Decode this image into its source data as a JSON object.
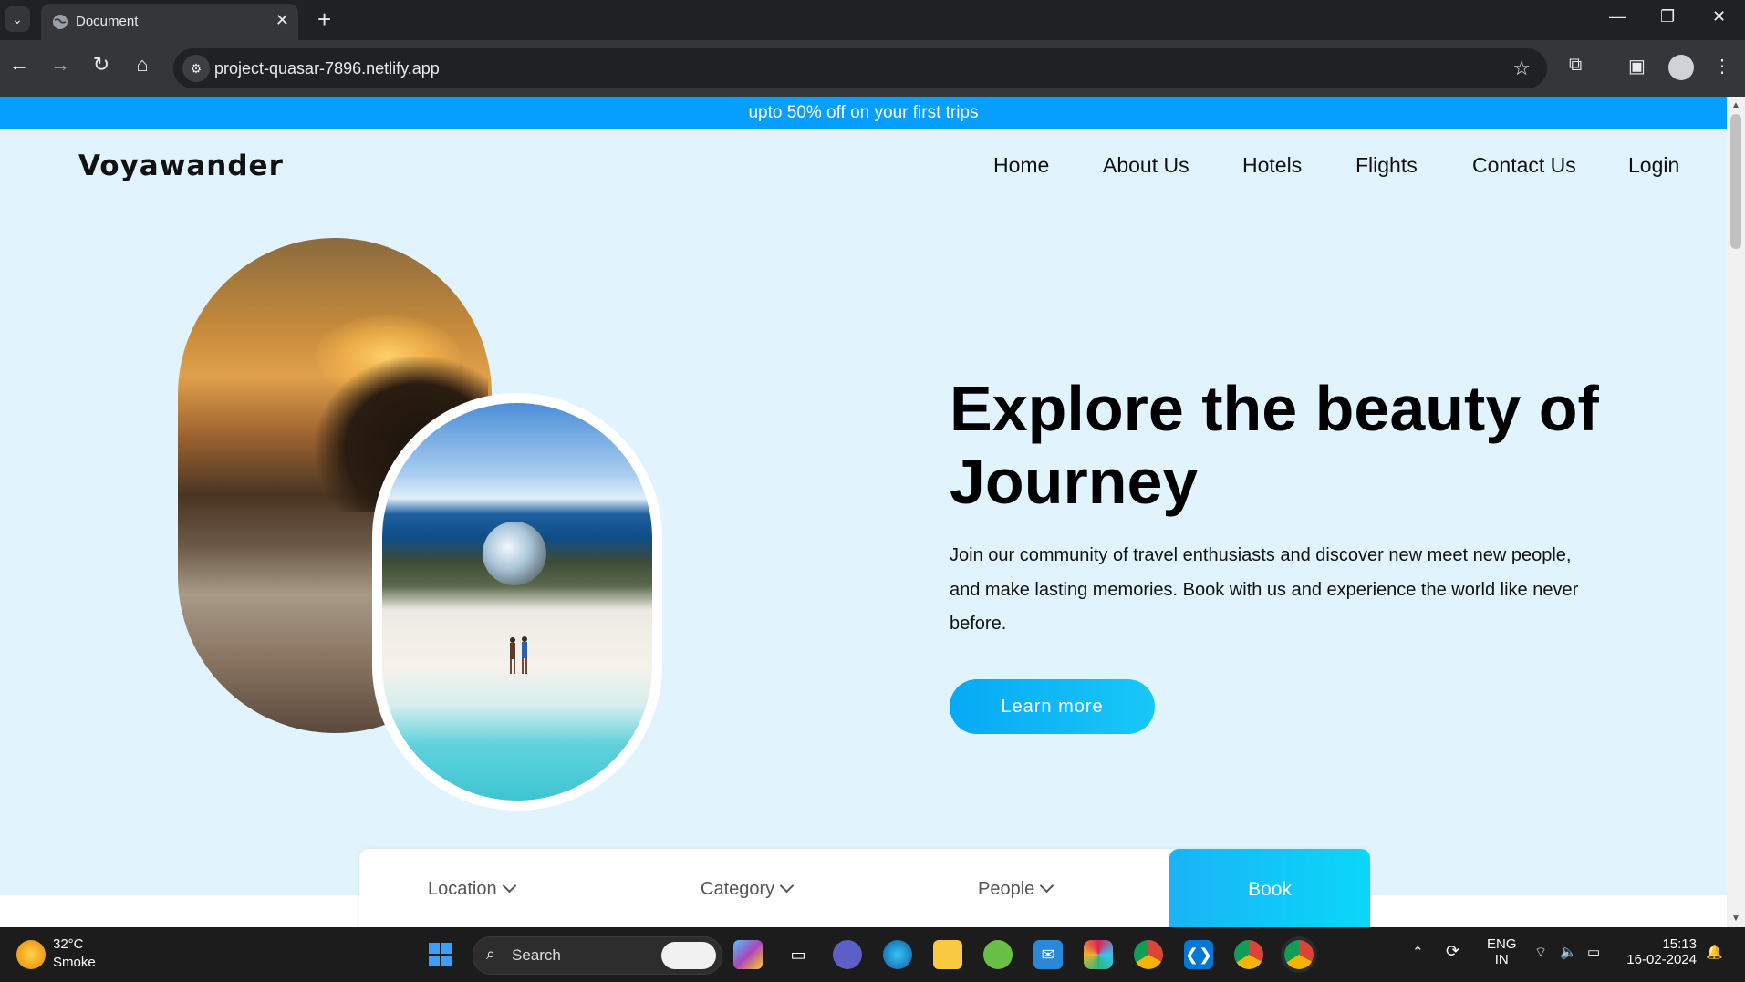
{
  "browser": {
    "tab_title": "Document",
    "url": "project-quasar-7896.netlify.app",
    "new_tab_symbol": "+",
    "tab_close_symbol": "✕"
  },
  "page": {
    "promo_banner": "upto 50% off on your first trips",
    "brand": "Voyawander",
    "nav": [
      "Home",
      "About Us",
      "Hotels",
      "Flights",
      "Contact Us",
      "Login"
    ],
    "hero": {
      "headline": "Explore the beauty of Journey",
      "description": "Join our community of travel enthusiasts and discover new meet new people, and make lasting memories. Book with us and experience the world like never before.",
      "cta": "Learn more"
    },
    "booking": {
      "location": "Location",
      "category": "Category",
      "people": "People",
      "book": "Book"
    }
  },
  "taskbar": {
    "weather_temp": "32°C",
    "weather_cond": "Smoke",
    "search_label": "Search",
    "lang_top": "ENG",
    "lang_bottom": "IN",
    "time": "15:13",
    "date": "16-02-2024"
  },
  "colors": {
    "promo": "#069eff",
    "page_bg": "#e1f3fd",
    "cta": "#07a9f5",
    "book": "#0ad7f8"
  }
}
